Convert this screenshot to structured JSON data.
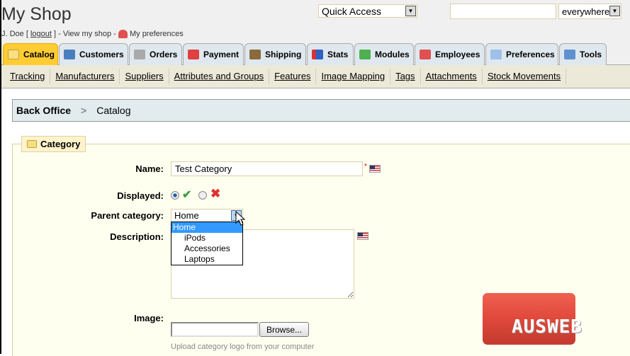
{
  "header": {
    "title": "My Shop",
    "user": "J. Doe [",
    "logout": "logout",
    "user_end": "] - View my shop -",
    "preferences": "My preferences",
    "quick_access": "Quick Access",
    "search_value": "",
    "search_scope": "everywhere"
  },
  "tabs": [
    {
      "label": "Catalog",
      "icon": "folder-icon",
      "color": "#e8c040"
    },
    {
      "label": "Customers",
      "icon": "user-icon",
      "color": "#4a7fbf"
    },
    {
      "label": "Orders",
      "icon": "cart-icon",
      "color": "#999999"
    },
    {
      "label": "Payment",
      "icon": "payment-icon",
      "color": "#e04040"
    },
    {
      "label": "Shipping",
      "icon": "truck-icon",
      "color": "#8a6a3a"
    },
    {
      "label": "Stats",
      "icon": "chart-icon",
      "color": "#3060c0"
    },
    {
      "label": "Modules",
      "icon": "puzzle-icon",
      "color": "#50b050"
    },
    {
      "label": "Employees",
      "icon": "person-icon",
      "color": "#e05050"
    },
    {
      "label": "Preferences",
      "icon": "pencil-icon",
      "color": "#7aa0d0"
    },
    {
      "label": "Tools",
      "icon": "wrench-icon",
      "color": "#6090d0"
    }
  ],
  "subnav": [
    "Tracking",
    "Manufacturers",
    "Suppliers",
    "Attributes and Groups",
    "Features",
    "Image Mapping",
    "Tags",
    "Attachments",
    "Stock Movements"
  ],
  "breadcrumb": {
    "root": "Back Office",
    "current": "Catalog"
  },
  "form": {
    "legend": "Category",
    "name_label": "Name:",
    "name_value": "Test Category",
    "required": "*",
    "displayed_label": "Displayed:",
    "displayed": "yes",
    "parent_label": "Parent category:",
    "parent_value": "Home",
    "parent_options": [
      "Home",
      "iPods",
      "Accessories",
      "Laptops"
    ],
    "description_label": "Description:",
    "image_label": "Image:",
    "browse": "Browse...",
    "hint": "Upload category logo from your computer"
  },
  "watermark": "AUSWEB"
}
